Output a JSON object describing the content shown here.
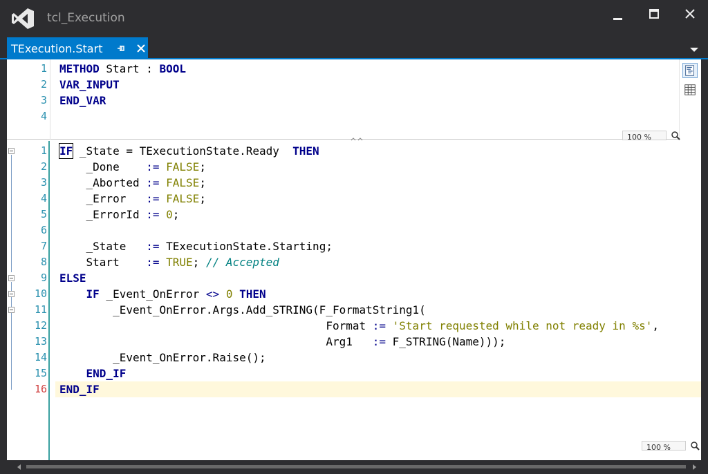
{
  "window": {
    "title": "tcl_Execution",
    "accent": "#007acc"
  },
  "tab": {
    "label": "TExecution.Start",
    "pin_icon": "pin-icon",
    "close_icon": "close-icon"
  },
  "declaration": {
    "line_numbers": [
      "1",
      "2",
      "3",
      "4"
    ],
    "zoom": "100 %"
  },
  "implementation": {
    "line_numbers": [
      "1",
      "2",
      "3",
      "4",
      "5",
      "6",
      "7",
      "8",
      "9",
      "10",
      "11",
      "12",
      "13",
      "14",
      "15",
      "16"
    ],
    "current_line": "16",
    "zoom": "100 %"
  },
  "code": {
    "decl": {
      "l1_kw": "METHOD",
      "l1_name": " Start : ",
      "l1_type": "BOOL",
      "l2_kw": "VAR_INPUT",
      "l3_kw": "END_VAR"
    },
    "impl": {
      "if_kw": "IF",
      "l1_rest": " _State = TExecutionState.Ready  ",
      "then_kw": "THEN",
      "done_name": "    _Done    ",
      "aborted_name": "    _Aborted ",
      "error_name": "    _Error   ",
      "errorid_name": "    _ErrorId ",
      "assign": ":=",
      "false": "FALSE",
      "zero": "0",
      "semi": ";",
      "state_name": "    _State   ",
      "starting": " TExecutionState.Starting;",
      "start_name": "    Start    ",
      "true": "TRUE",
      "comment": "// Accepted",
      "else_kw": "ELSE",
      "inner_if_kw": "    IF",
      "on_error_rest": " _Event_OnError ",
      "neq": "<>",
      "args_call": "        _Event_OnError.Args.Add_STRING(F_FormatString1(",
      "format_indent": "                                        Format ",
      "format_str": "'Start requested while not ready in %s'",
      "comma": ",",
      "arg1_indent": "                                        Arg1   ",
      "f_string": " F_STRING(Name)));",
      "raise_call": "        _Event_OnError.Raise();",
      "end_if_inner": "    END_IF",
      "end_if_outer": "END_IF"
    }
  }
}
